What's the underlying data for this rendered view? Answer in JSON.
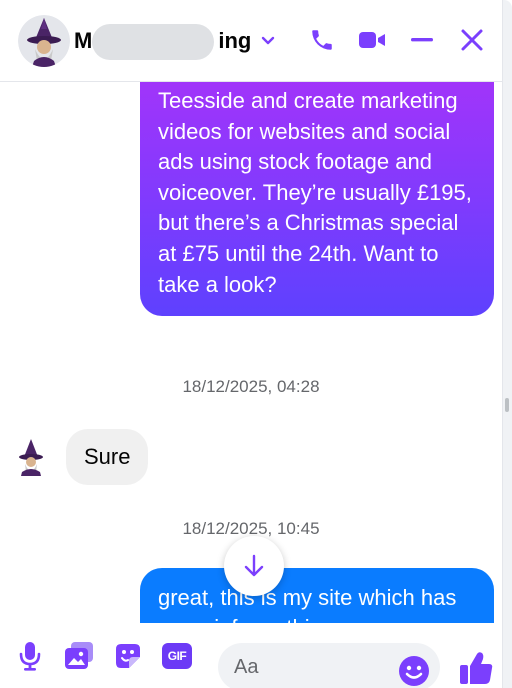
{
  "header": {
    "contact_name_start": "M",
    "contact_name_end": "ing",
    "icons": {
      "chevron": "chevron-down-icon",
      "call": "phone-icon",
      "video": "video-camera-icon",
      "minimize": "minimize-icon",
      "close": "close-icon"
    }
  },
  "conversation": {
    "outgoing_message_1": "Teesside and create marketing videos for websites and social ads using stock footage and voiceover. They’re usually £195, but there’s a Christmas special at £75 until the 24th. Want to take a look?",
    "timestamp_1": "18/12/2025, 04:28",
    "incoming_message": "Sure",
    "timestamp_2": "18/12/2025, 10:45",
    "outgoing_message_2": "great, this is my site which has more info on things"
  },
  "composer": {
    "placeholder": "Aa",
    "gif_label": "GIF",
    "icons": [
      "microphone-icon",
      "photo-icon",
      "sticker-icon",
      "gif-icon",
      "emoji-icon",
      "thumbs-up-icon"
    ]
  },
  "colors": {
    "accent": "#7b3ffd",
    "outgoing_gradient_top": "#a334fa",
    "outgoing_gradient_bottom": "#5e41fe",
    "outgoing_blue": "#0a7cff",
    "incoming_bubble": "#f0f0f0",
    "timestamp": "#65676b"
  }
}
